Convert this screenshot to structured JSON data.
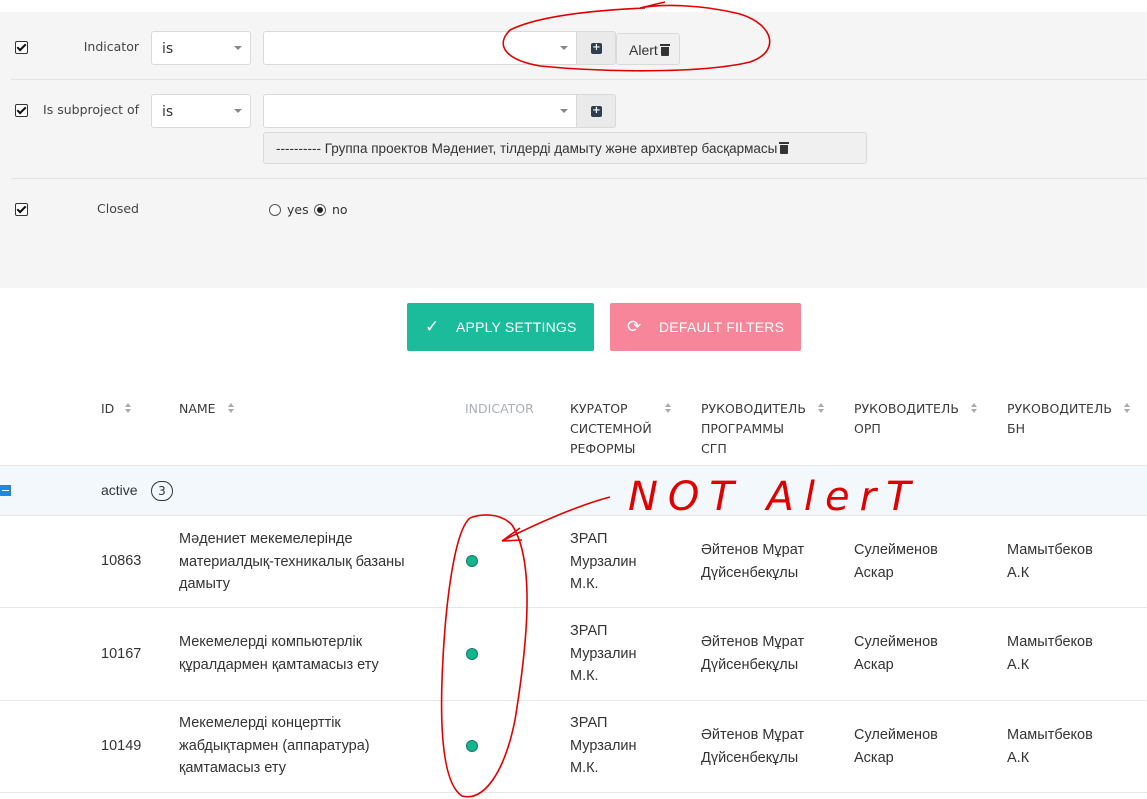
{
  "filters": {
    "rows": [
      {
        "label": "Indicator",
        "operator": "is",
        "value": "",
        "tags": [
          "Alert"
        ]
      },
      {
        "label": "Is subproject of",
        "operator": "is",
        "value": "",
        "tags": [
          "---------- Группа проектов Мәдениет, тілдерді дамыту және архивтер басқармасы"
        ]
      },
      {
        "label": "Closed",
        "options": [
          "yes",
          "no"
        ],
        "selected": "no"
      }
    ]
  },
  "buttons": {
    "apply": "APPLY SETTINGS",
    "default": "DEFAULT FILTERS",
    "apply_color": "#1abc9c",
    "default_color": "#f7869a"
  },
  "table": {
    "columns": [
      {
        "label": "ID"
      },
      {
        "label": "NAME"
      },
      {
        "label": "INDICATOR"
      },
      {
        "label": "КУРАТОР СИСТЕМНОЙ РЕФОРМЫ"
      },
      {
        "label": "РУКОВОДИТЕЛЬ ПРОГРАММЫ СГП"
      },
      {
        "label": "РУКОВОДИТЕЛЬ ОРП"
      },
      {
        "label": "РУКОВОДИТЕЛЬ БН"
      }
    ],
    "group": {
      "label": "active",
      "count": "3"
    },
    "rows": [
      {
        "id": "10863",
        "name": "Мәдениет мекемелерінде материалдық-техникалық базаны дамыту",
        "indicator_color": "#16b48d",
        "curator": "ЗРАП Мурзалин М.К.",
        "sgp": "Әйтенов Мұрат Дүйсенбекұлы",
        "orp": "Сулейменов Аскар",
        "bn": "Мамытбеков А.К"
      },
      {
        "id": "10167",
        "name": "Мекемелерді компьютерлік құралдармен қамтамасыз ету",
        "indicator_color": "#16b48d",
        "curator": "ЗРАП Мурзалин М.К.",
        "sgp": "Әйтенов Мұрат Дүйсенбекұлы",
        "orp": "Сулейменов Аскар",
        "bn": "Мамытбеков А.К"
      },
      {
        "id": "10149",
        "name": "Мекемелерді концерттік жабдықтармен (аппаратура) қамтамасыз ету",
        "indicator_color": "#16b48d",
        "curator": "ЗРАП Мурзалин М.К.",
        "sgp": "Әйтенов Мұрат Дүйсенбекұлы",
        "orp": "Сулейменов Аскар",
        "bn": "Мамытбеков А.К"
      }
    ]
  },
  "annotation": {
    "text": "NOT AlerT",
    "color": "#e00000"
  }
}
